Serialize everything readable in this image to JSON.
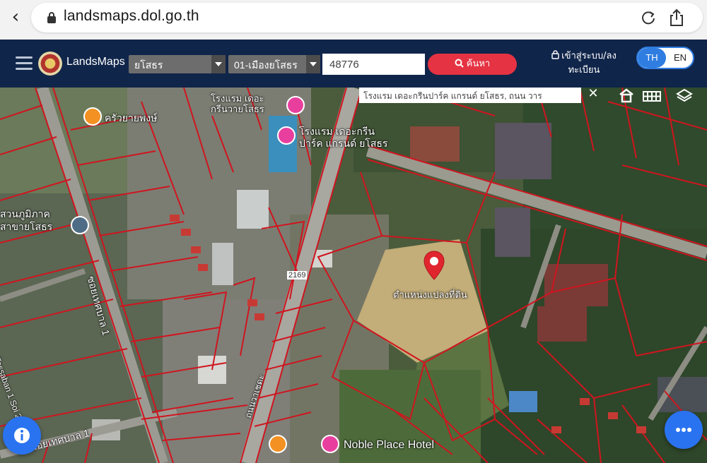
{
  "browser": {
    "url": "landsmaps.dol.go.th"
  },
  "header": {
    "brand": "LandsMaps",
    "province_select": "ยโสธร",
    "district_select": "01-เมืองยโสธร",
    "parcel_number": "48776",
    "search_label": "ค้นหา",
    "login_label": "เข้าสู่ระบบ/ลงทะเบียน",
    "lang": {
      "th": "TH",
      "en": "EN",
      "active": "TH"
    }
  },
  "map": {
    "search_result": "โรงแรม เดอะกรีนปาร์ค แกรนด์ ยโสธร, ถนน วาร",
    "close_symbol": "✕",
    "labels": {
      "hotel_top": "โรงแรม เดอะ\nกรีนวายโสธร",
      "hotel_green_park": "โรงแรม เดอะกรีน\nปาร์ค แกรนด์ ยโสธร",
      "restaurant": "ครัวยายพงษ์",
      "park": "สวนภูมิภาค\nสาขายโสธร",
      "road_soi_left": "ซอยเทศบาล 1",
      "road_tessaban_sol2": "Tessaban 1 Soi 2",
      "road_route": "2169",
      "parcel_location": "ตำแหน่งแปลงที่ดิน",
      "road_bottom_left": "ซอยเทศบาล 1",
      "road_bottom_mid": "ถนนวาเชดะ",
      "noble_place": "Noble Place Hotel"
    },
    "colors": {
      "parcel_lines": "#d0151f",
      "marker": "#e0252e",
      "header_bg": "#10254a",
      "search_button": "#e53343",
      "fab": "#2a73f0"
    },
    "icons": [
      "hotel-icon",
      "restaurant-icon",
      "government-icon",
      "location-marker-icon",
      "house-icon",
      "grid-icon",
      "layers-icon",
      "info-icon",
      "more-icon"
    ]
  }
}
